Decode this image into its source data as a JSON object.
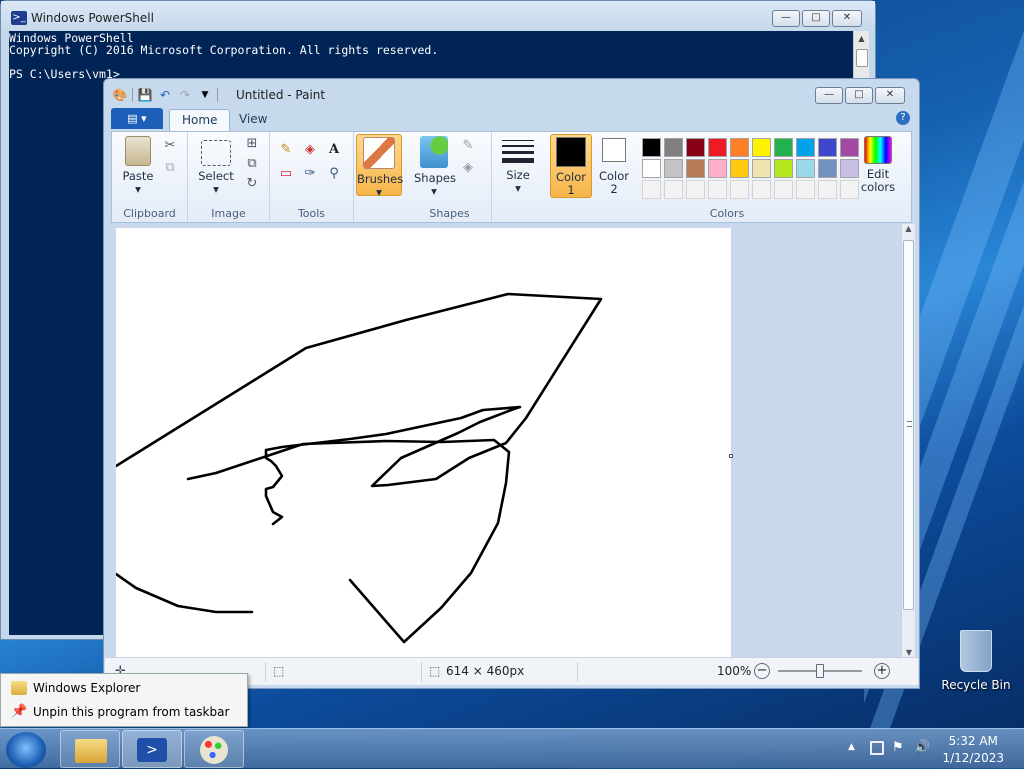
{
  "powershell": {
    "title": "Windows PowerShell",
    "lines": [
      "Windows PowerShell",
      "Copyright (C) 2016 Microsoft Corporation. All rights reserved.",
      "",
      "PS C:\\Users\\vm1>"
    ]
  },
  "paint": {
    "title": "Untitled - Paint",
    "tabs": {
      "file": "▤ ▾",
      "home": "Home",
      "view": "View"
    },
    "clipboard": {
      "paste": "Paste",
      "group": "Clipboard"
    },
    "image": {
      "select": "Select",
      "group": "Image"
    },
    "tools": {
      "group": "Tools",
      "text_glyph": "A"
    },
    "brushes": {
      "label": "Brushes"
    },
    "shapes": {
      "label": "Shapes",
      "group": "Shapes"
    },
    "size": {
      "label": "Size"
    },
    "color1": {
      "line1": "Color",
      "line2": "1",
      "value": "#000000"
    },
    "color2": {
      "line1": "Color",
      "line2": "2",
      "value": "#ffffff"
    },
    "colors": {
      "group": "Colors"
    },
    "edit_colors": {
      "line1": "Edit",
      "line2": "colors"
    },
    "palette_row1": [
      "#000000",
      "#7f7f7f",
      "#880015",
      "#ed1c24",
      "#ff7f27",
      "#fff200",
      "#22b14c",
      "#00a2e8",
      "#3f48cc",
      "#a349a4"
    ],
    "palette_row2": [
      "#ffffff",
      "#c3c3c3",
      "#b97a57",
      "#ffaec9",
      "#ffc90e",
      "#efe4b0",
      "#b5e61d",
      "#99d9ea",
      "#7092be",
      "#c8bfe7"
    ],
    "status": {
      "dimensions": "614 × 460px",
      "zoom": "100%"
    }
  },
  "context_menu": {
    "items": [
      "Windows Explorer",
      "Unpin this program from taskbar"
    ]
  },
  "taskbar": {
    "time": "5:32 AM",
    "date": "1/12/2023"
  },
  "desktop": {
    "recycle_bin": "Recycle Bin"
  }
}
